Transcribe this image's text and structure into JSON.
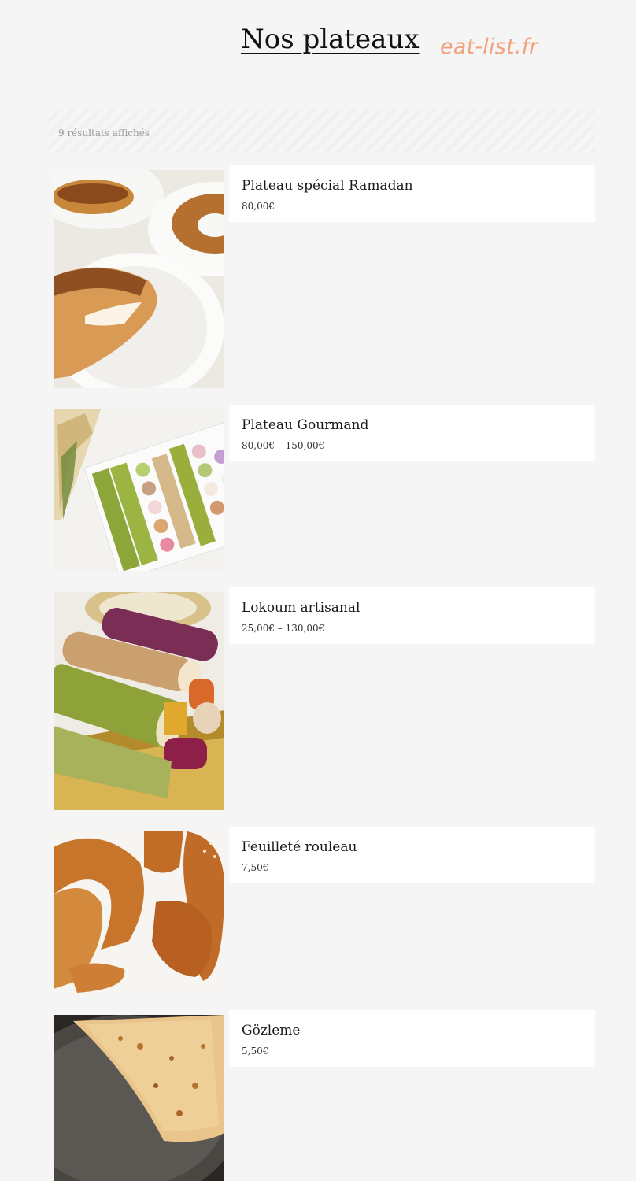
{
  "page": {
    "title": "Nos plateaux",
    "watermark": "eat-list.fr"
  },
  "results": {
    "count_text": "9 résultats affichés"
  },
  "products": [
    {
      "name": "Plateau spécial Ramadan",
      "price": "80,00€"
    },
    {
      "name": "Plateau Gourmand",
      "price": "80,00€ – 150,00€"
    },
    {
      "name": "Lokoum artisanal",
      "price": "25,00€ – 130,00€"
    },
    {
      "name": "Feuilleté rouleau",
      "price": "7,50€"
    },
    {
      "name": "Gözleme",
      "price": "5,50€"
    }
  ]
}
